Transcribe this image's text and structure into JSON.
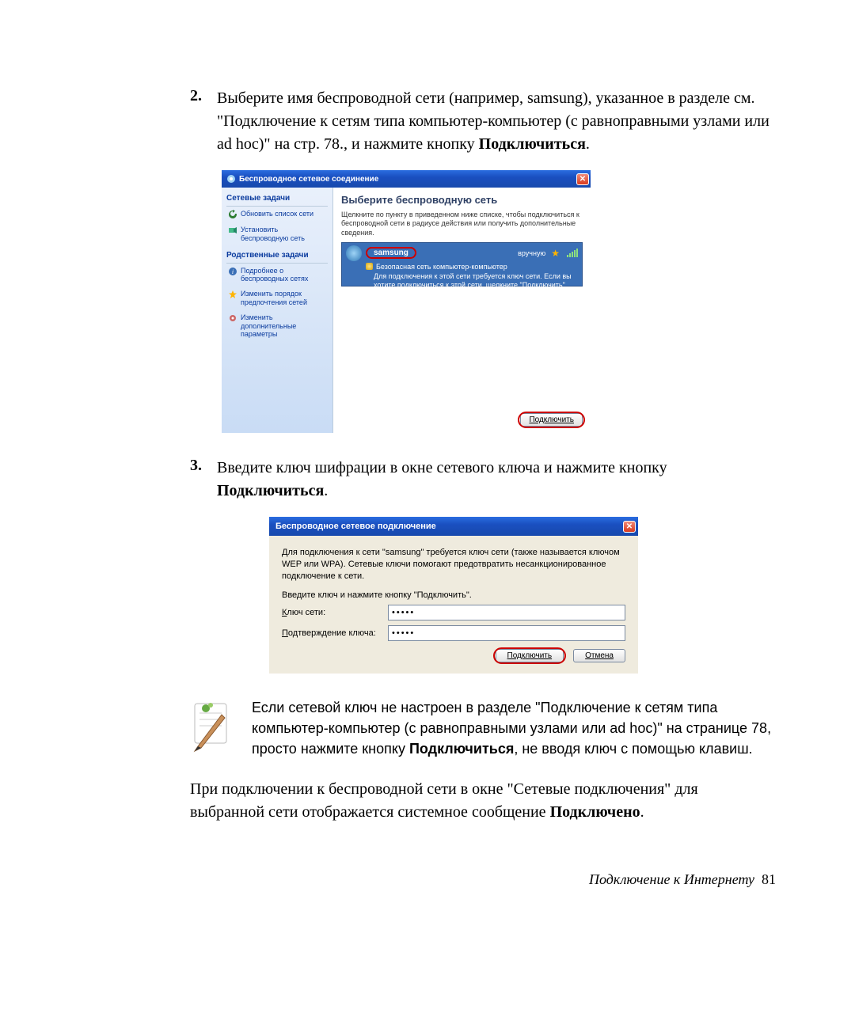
{
  "step2": {
    "num": "2.",
    "text_a": "Выберите имя беспроводной сети (например, samsung), указанное в разделе см. \"Подключение к сетям типа компьютер-компьютер (с равноправными узлами или ad hoc)\" на стр. 78., и нажмите кнопку ",
    "text_b": "Подключиться",
    "text_c": "."
  },
  "win1": {
    "title": "Беспроводное сетевое соединение",
    "side_heading_1": "Сетевые задачи",
    "link_refresh": "Обновить список сети",
    "link_setup": "Установить беспроводную сеть",
    "side_heading_2": "Родственные задачи",
    "link_learn": "Подробнее о беспроводных сетях",
    "link_order": "Изменить порядок предпочтения сетей",
    "link_adv": "Изменить дополнительные параметры",
    "main_title": "Выберите беспроводную сеть",
    "main_desc": "Щелкните по пункту в приведенном ниже списке, чтобы подключиться к беспроводной сети в радиусе действия или получить дополнительные сведения.",
    "net": {
      "ssid": "samsung",
      "manual": "вручную",
      "sec_line": "Безопасная сеть компьютер-компьютер",
      "help": "Для подключения к этой сети требуется ключ сети. Если вы хотите подключиться к этой сети, щелкните \"Подключить\"."
    },
    "connect_btn": "Подключить"
  },
  "step3": {
    "num": "3.",
    "text_a": "Введите ключ шифрации в окне сетевого ключа и нажмите кнопку ",
    "text_b": "Подключиться",
    "text_c": "."
  },
  "win2": {
    "title": "Беспроводное сетевое подключение",
    "desc": "Для подключения к сети \"samsung\" требуется ключ сети (также называется ключом WEP или WPA). Сетевые ключи помогают предотвратить несанкционированное подключение к сети.",
    "hint": "Введите ключ и нажмите кнопку \"Подключить\".",
    "key_label_u": "К",
    "key_label_rest": "люч сети:",
    "confirm_label_u": "П",
    "confirm_label_rest": "одтверждение ключа:",
    "key_value": "•••••",
    "confirm_value": "•••••",
    "btn_connect_pre": "Подк",
    "btn_connect_u": "л",
    "btn_connect_post": "ючить",
    "btn_cancel": "Отмена"
  },
  "note": {
    "text_a": "Если сетевой ключ не настроен в разделе ",
    "text_b": "\"Подключение к сетям типа компьютер-компьютер (с равноправными узлами или ad hoc)\" на странице 78, ",
    "text_c": "просто нажмите кнопку ",
    "text_d": "Подключиться",
    "text_e": ", не вводя ключ с помощью клавиш",
    "text_f": "."
  },
  "para": {
    "a": "При подключении к беспроводной сети в окне \"Сетевые подключения\" для выбранной сети отображается системное сообщение ",
    "b": "Подключено",
    "c": "."
  },
  "footer": {
    "text": "Подключение к Интернету",
    "page": "81"
  }
}
